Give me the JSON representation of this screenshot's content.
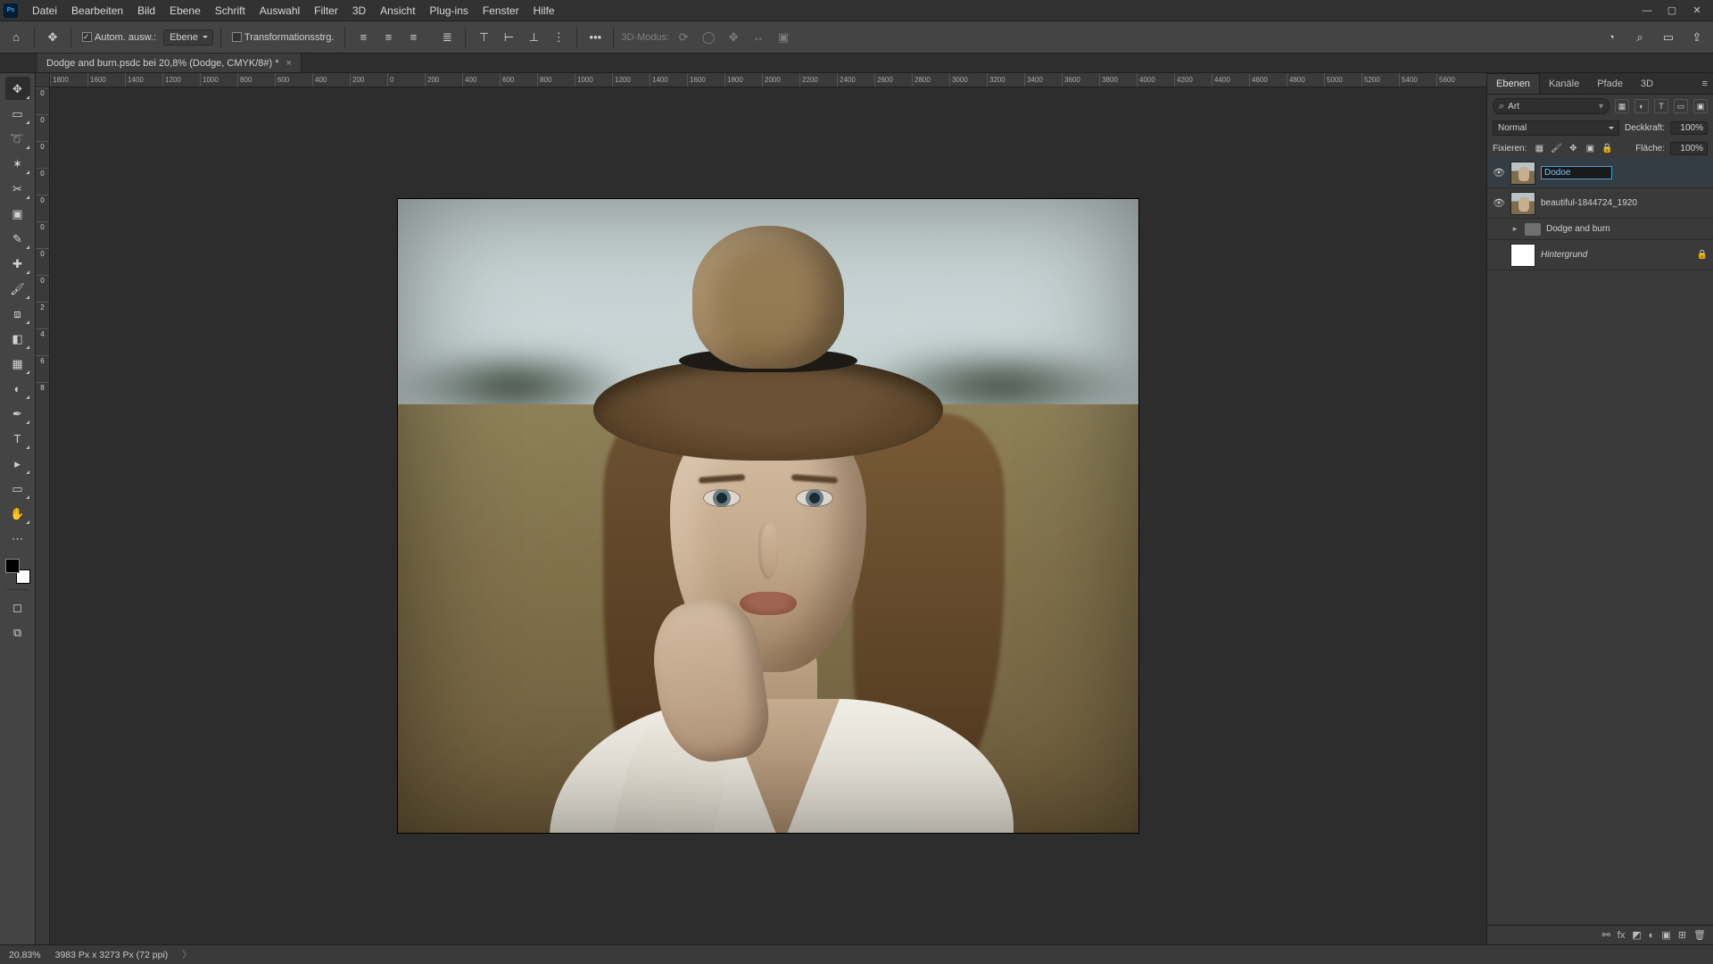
{
  "menus": [
    "Datei",
    "Bearbeiten",
    "Bild",
    "Ebene",
    "Schrift",
    "Auswahl",
    "Filter",
    "3D",
    "Ansicht",
    "Plug-ins",
    "Fenster",
    "Hilfe"
  ],
  "options": {
    "auto_select_label": "Autom. ausw.:",
    "auto_select_mode": "Ebene",
    "transform_label": "Transformationsstrg.",
    "mode3d_label": "3D-Modus:"
  },
  "doc": {
    "tab_title": "Dodge and burn.psdc bei 20,8% (Dodge, CMYK/8#) *"
  },
  "ruler_h": [
    "1800",
    "1600",
    "1400",
    "1200",
    "1000",
    "800",
    "600",
    "400",
    "200",
    "0",
    "200",
    "400",
    "600",
    "800",
    "1000",
    "1200",
    "1400",
    "1600",
    "1800",
    "2000",
    "2200",
    "2400",
    "2600",
    "2800",
    "3000",
    "3200",
    "3400",
    "3600",
    "3800",
    "4000",
    "4200",
    "4400",
    "4600",
    "4800",
    "5000",
    "5200",
    "5400",
    "5600"
  ],
  "ruler_v": [
    "0",
    "0",
    "0",
    "0",
    "0",
    "0",
    "0",
    "0",
    "2",
    "4",
    "6",
    "8"
  ],
  "panels": {
    "tabs": [
      "Ebenen",
      "Kanäle",
      "Pfade",
      "3D"
    ],
    "search_placeholder": "Art",
    "blend_mode": "Normal",
    "opacity_label": "Deckkraft:",
    "opacity_value": "100%",
    "lock_label": "Fixieren:",
    "fill_label": "Fläche:",
    "fill_value": "100%"
  },
  "layers": [
    {
      "visible": true,
      "thumb": "img",
      "editing": true,
      "name": "Dodoe"
    },
    {
      "visible": true,
      "thumb": "img",
      "name": "beautiful-1844724_1920"
    },
    {
      "visible": false,
      "group": true,
      "name": "Dodge and burn"
    },
    {
      "visible": false,
      "thumb": "white",
      "name": "Hintergrund",
      "italic": true,
      "locked": true
    }
  ],
  "status": {
    "zoom": "20,83%",
    "dims": "3983 Px x 3273 Px (72 ppi)"
  }
}
